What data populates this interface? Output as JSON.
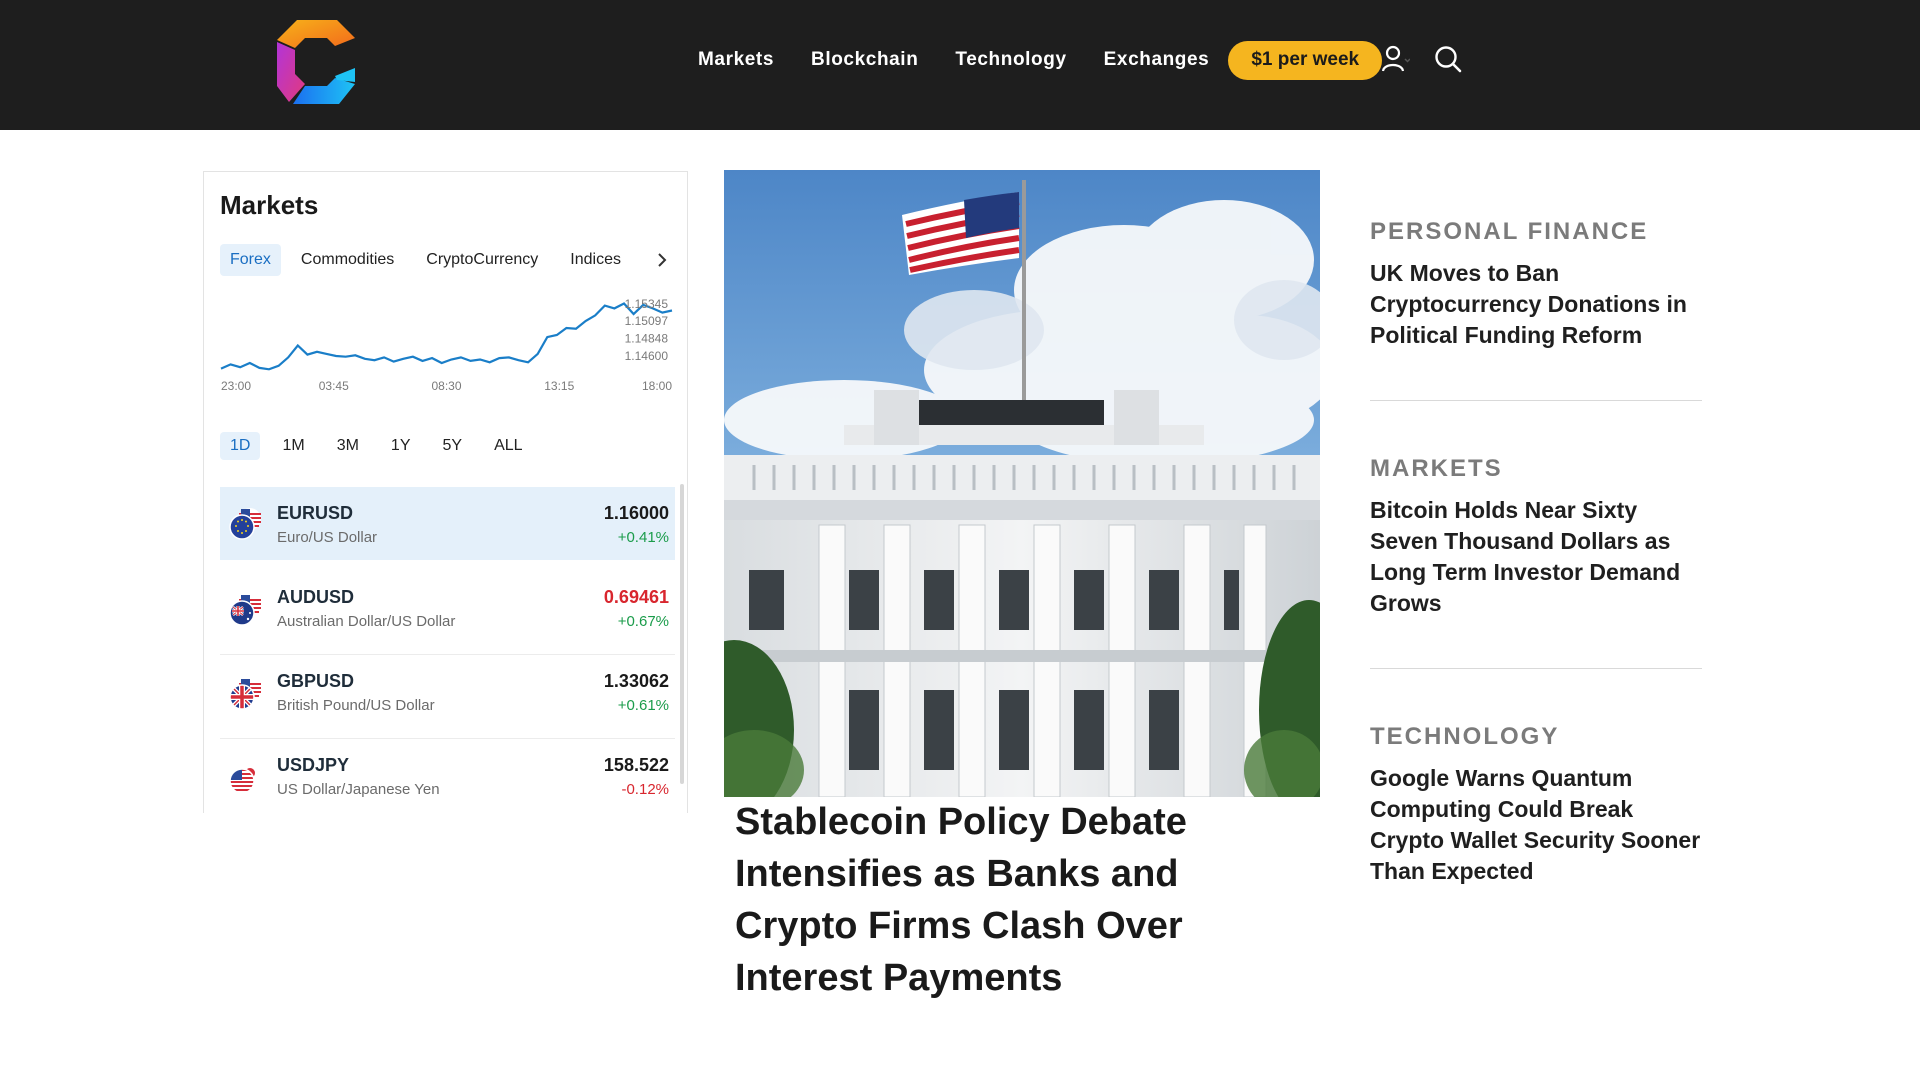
{
  "header": {
    "nav": [
      {
        "label": "Markets"
      },
      {
        "label": "Blockchain"
      },
      {
        "label": "Technology"
      },
      {
        "label": "Exchanges"
      }
    ],
    "subscribe_label": "$1 per week",
    "icons": [
      "user-icon",
      "search-icon"
    ]
  },
  "markets_widget": {
    "title": "Markets",
    "tabs": [
      "Forex",
      "Commodities",
      "CryptoCurrency",
      "Indices"
    ],
    "active_tab": "Forex",
    "ranges": [
      "1D",
      "1M",
      "3M",
      "1Y",
      "5Y",
      "ALL"
    ],
    "active_range": "1D",
    "rows": [
      {
        "symbol": "EURUSD",
        "name": "Euro/US Dollar",
        "price": "1.16000",
        "change": "+0.41%",
        "direction": "up",
        "selected": true
      },
      {
        "symbol": "AUDUSD",
        "name": "Australian Dollar/US Dollar",
        "price": "0.69461",
        "change": "+0.67%",
        "direction": "up",
        "price_color": "#d8262e"
      },
      {
        "symbol": "GBPUSD",
        "name": "British Pound/US Dollar",
        "price": "1.33062",
        "change": "+0.61%",
        "direction": "up"
      },
      {
        "symbol": "USDJPY",
        "name": "US Dollar/Japanese Yen",
        "price": "158.522",
        "change": "-0.12%",
        "direction": "down"
      }
    ]
  },
  "chart_data": {
    "type": "line",
    "x_ticks": [
      "23:00",
      "03:45",
      "08:30",
      "13:15",
      "18:00"
    ],
    "y_ticks": [
      "1.15345",
      "1.15097",
      "1.14848",
      "1.14600"
    ],
    "ylim": [
      1.144,
      1.154
    ],
    "series": [
      {
        "values": [
          1.1442,
          1.1448,
          1.1444,
          1.145,
          1.1443,
          1.1441,
          1.1446,
          1.1458,
          1.1475,
          1.1462,
          1.1466,
          1.1463,
          1.146,
          1.1459,
          1.1461,
          1.1456,
          1.1454,
          1.1458,
          1.1452,
          1.1456,
          1.1459,
          1.1453,
          1.1457,
          1.145,
          1.1455,
          1.1458,
          1.1453,
          1.1455,
          1.1451,
          1.1457,
          1.1458,
          1.1454,
          1.1451,
          1.1463,
          1.1487,
          1.149,
          1.15,
          1.1499,
          1.151,
          1.1518,
          1.1532,
          1.1528,
          1.1535,
          1.152,
          1.1533,
          1.1528,
          1.1522,
          1.1525
        ]
      }
    ],
    "color": "#1a7ec8",
    "grid": false
  },
  "hero": {
    "headline": "Stablecoin Policy Debate Intensifies as Banks and Crypto Firms Clash Over Interest Payments"
  },
  "rail": [
    {
      "category": "PERSONAL FINANCE",
      "headline": "UK Moves to Ban Cryptocurrency Donations in Political Funding Reform"
    },
    {
      "category": "MARKETS",
      "headline": "Bitcoin Holds Near Sixty Seven Thousand Dollars as Long Term Investor Demand Grows"
    },
    {
      "category": "TECHNOLOGY",
      "headline": "Google Warns Quantum Computing Could Break Crypto Wallet Security Sooner Than Expected"
    }
  ]
}
